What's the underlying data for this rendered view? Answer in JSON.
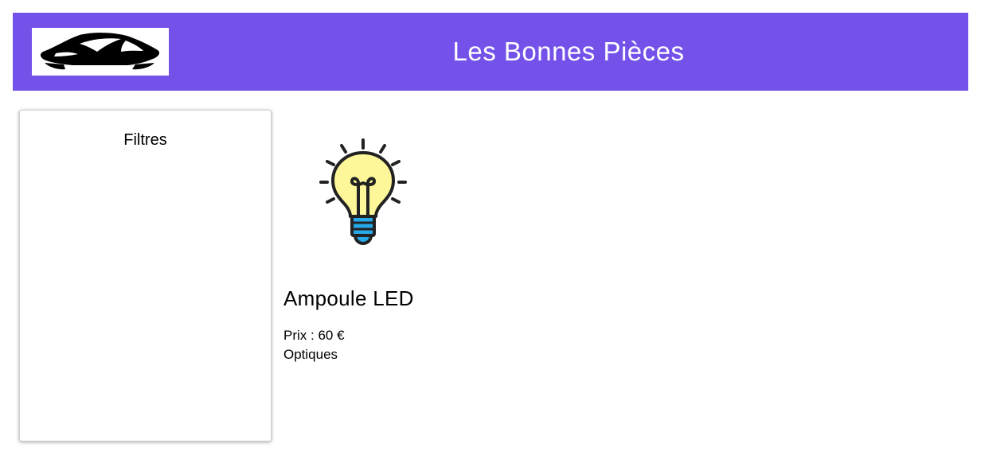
{
  "header": {
    "title": "Les Bonnes Pièces",
    "logo_icon": "car-silhouette-icon",
    "background_color": "#7452ea",
    "title_color": "#ffffff"
  },
  "filters": {
    "title": "Filtres"
  },
  "products": [
    {
      "image_icon": "light-bulb-icon",
      "name": "Ampoule LED",
      "price": "Prix : 60 €",
      "category": "Optiques"
    }
  ]
}
